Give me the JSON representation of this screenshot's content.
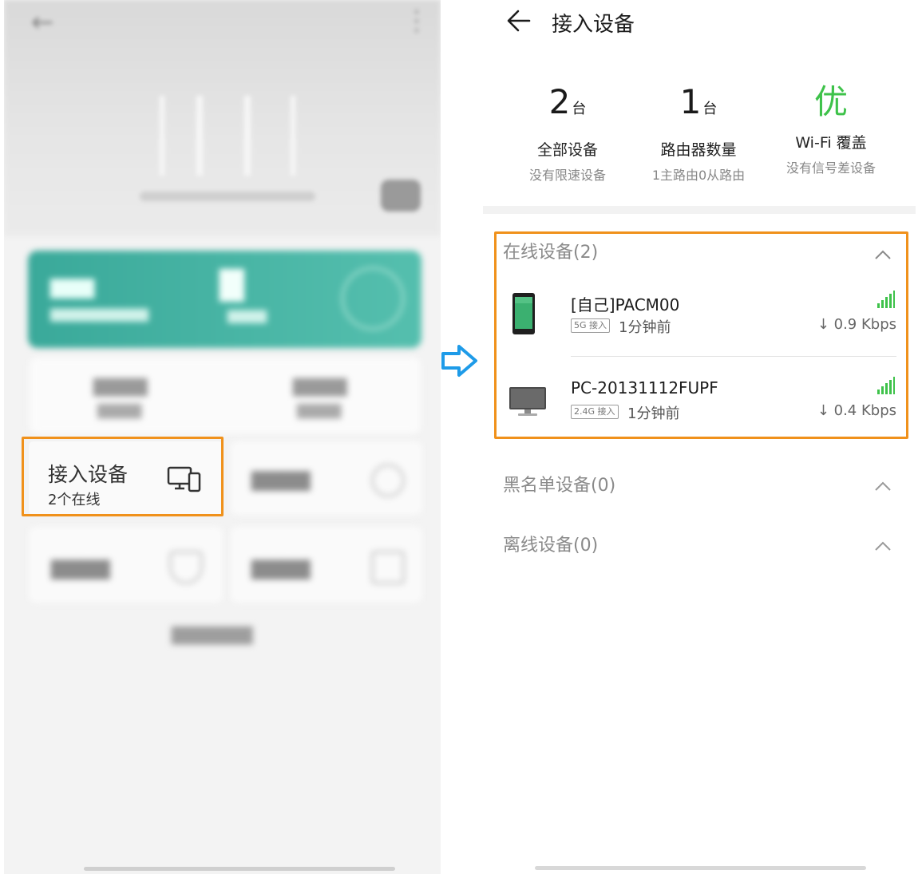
{
  "left_panel": {
    "tile_devices": {
      "title": "接入设备",
      "subtitle": "2个在线"
    }
  },
  "right_panel": {
    "header": {
      "title": "接入设备"
    },
    "stats": [
      {
        "value": "2",
        "unit": "台",
        "label": "全部设备",
        "sub": "没有限速设备"
      },
      {
        "value": "1",
        "unit": "台",
        "label": "路由器数量",
        "sub": "1主路由0从路由"
      },
      {
        "value": "优",
        "unit": "",
        "label": "Wi-Fi 覆盖",
        "sub": "没有信号差设备"
      }
    ],
    "sections": {
      "online": "在线设备(2)",
      "blacklist": "黑名单设备(0)",
      "offline": "离线设备(0)"
    },
    "devices": [
      {
        "name": "[自己]PACM00",
        "band": "5G 接入",
        "time": "1分钟前",
        "speed": "↓ 0.9 Kbps",
        "type": "phone-icon"
      },
      {
        "name": "PC-20131112FUPF",
        "band": "2.4G 接入",
        "time": "1分钟前",
        "speed": "↓ 0.4 Kbps",
        "type": "monitor-icon"
      }
    ]
  },
  "colors": {
    "highlight": "#f0911b",
    "signal": "#3ec24a",
    "quality": "#3ec24a",
    "arrow": "#1e9be8"
  }
}
